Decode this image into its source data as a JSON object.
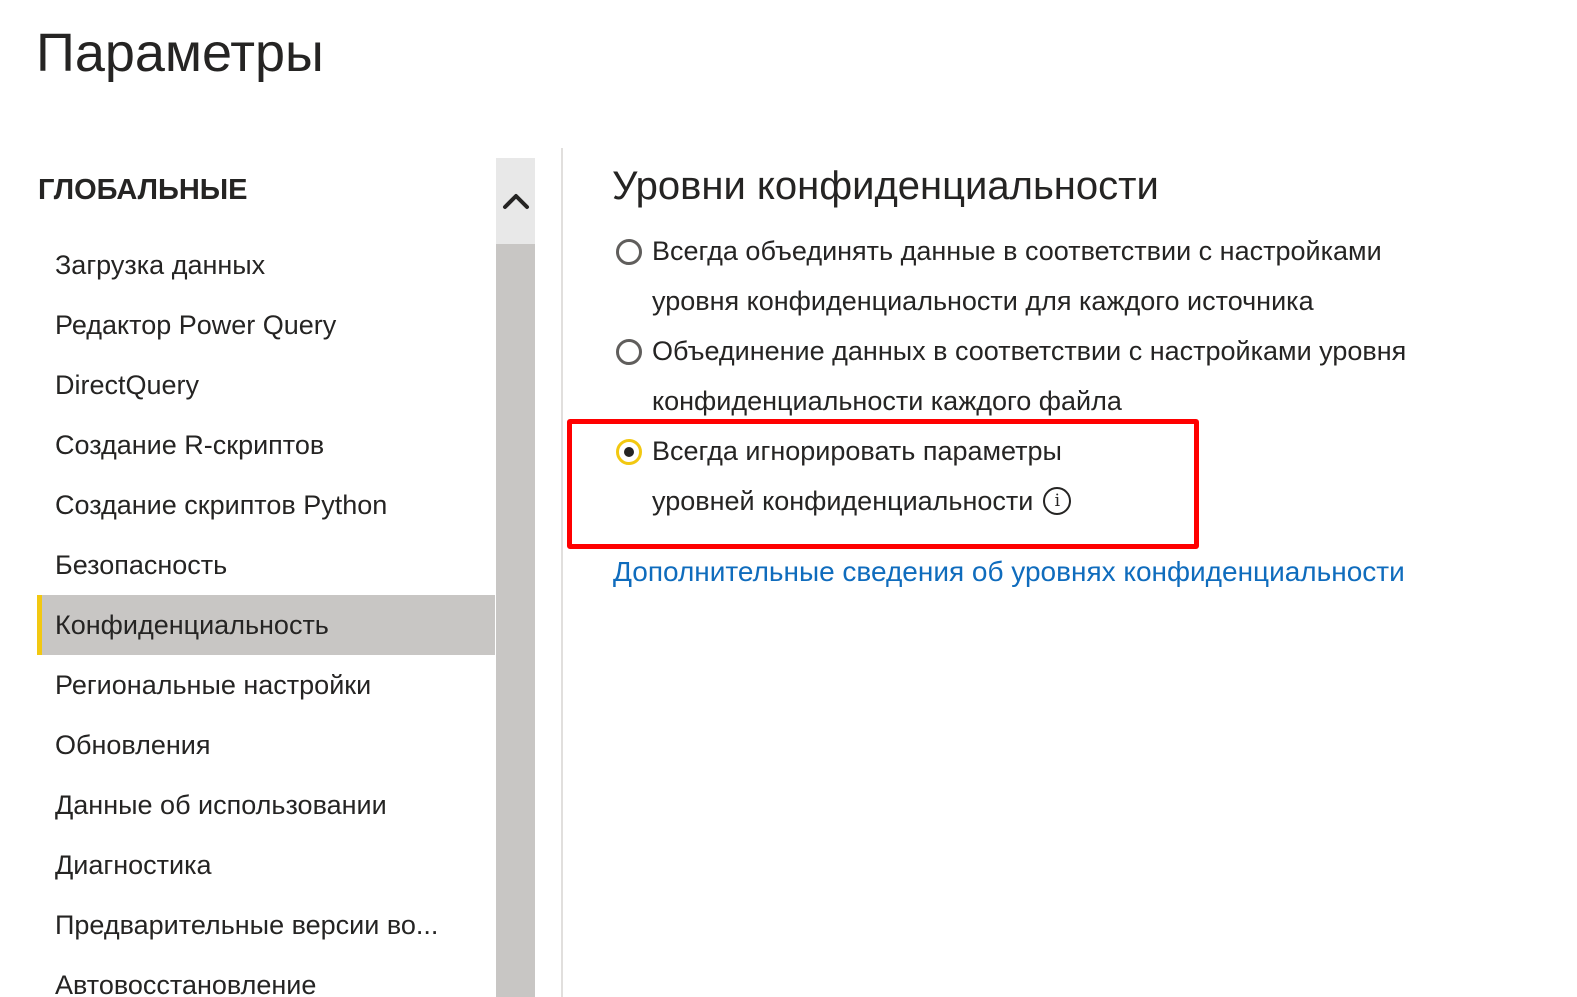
{
  "window": {
    "title": "Параметры"
  },
  "sidebar": {
    "section_header": "ГЛОБАЛЬНЫЕ",
    "items": [
      {
        "label": "Загрузка данных",
        "active": false
      },
      {
        "label": "Редактор Power Query",
        "active": false
      },
      {
        "label": "DirectQuery",
        "active": false
      },
      {
        "label": "Создание R-скриптов",
        "active": false
      },
      {
        "label": "Создание скриптов Python",
        "active": false
      },
      {
        "label": "Безопасность",
        "active": false
      },
      {
        "label": "Конфиденциальность",
        "active": true
      },
      {
        "label": "Региональные настройки",
        "active": false
      },
      {
        "label": "Обновления",
        "active": false
      },
      {
        "label": "Данные об использовании",
        "active": false
      },
      {
        "label": "Диагностика",
        "active": false
      },
      {
        "label": "Предварительные версии во...",
        "active": false
      },
      {
        "label": "Автовосстановление",
        "active": false
      }
    ]
  },
  "scrollbar": {
    "up_icon": "chevron-up-icon"
  },
  "main": {
    "title": "Уровни конфиденциальности",
    "options": [
      {
        "line1": "Всегда объединять данные в соответствии с настройками",
        "line2": "уровня конфиденциальности для каждого источника",
        "checked": false
      },
      {
        "line1": "Объединение данных в соответствии с настройками уровня",
        "line2": "конфиденциальности каждого файла",
        "checked": false
      },
      {
        "line1": "Всегда игнорировать параметры",
        "line2": "уровней конфиденциальности",
        "checked": true
      }
    ],
    "info_icon": "i",
    "link": "Дополнительные сведения об уровнях конфиденциальности"
  },
  "colors": {
    "accent": "#f2c811",
    "highlight_box": "#ff0000",
    "link": "#0f6cbd",
    "active_bg": "#c8c6c4"
  }
}
